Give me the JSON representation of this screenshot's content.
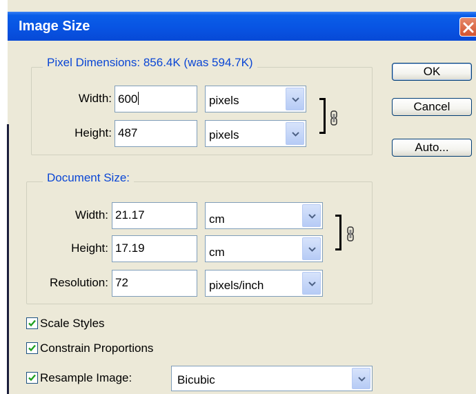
{
  "dialog": {
    "title": "Image Size"
  },
  "pixel_dimensions": {
    "legend": "Pixel Dimensions:  856.4K (was 594.7K)",
    "width_label": "Width:",
    "width_value": "600",
    "width_unit": "pixels",
    "height_label": "Height:",
    "height_value": "487",
    "height_unit": "pixels"
  },
  "document_size": {
    "legend": "Document Size:",
    "width_label": "Width:",
    "width_value": "21.17",
    "width_unit": "cm",
    "height_label": "Height:",
    "height_value": "17.19",
    "height_unit": "cm",
    "resolution_label": "Resolution:",
    "resolution_value": "72",
    "resolution_unit": "pixels/inch"
  },
  "options": {
    "scale_styles": {
      "label": "Scale Styles",
      "checked": true
    },
    "constrain_proportions": {
      "label": "Constrain Proportions",
      "checked": true
    },
    "resample_image": {
      "label": "Resample Image:",
      "checked": true,
      "method": "Bicubic"
    }
  },
  "buttons": {
    "ok": "OK",
    "cancel": "Cancel",
    "auto": "Auto..."
  },
  "icons": {
    "link": "chain-link-icon",
    "dropdown": "chevron-down-icon",
    "close": "close-icon",
    "check": "checkmark-icon"
  },
  "colors": {
    "titlebar": "#0854e3",
    "legend_text": "#0a46d5",
    "dialog_bg": "#ece9d8"
  }
}
